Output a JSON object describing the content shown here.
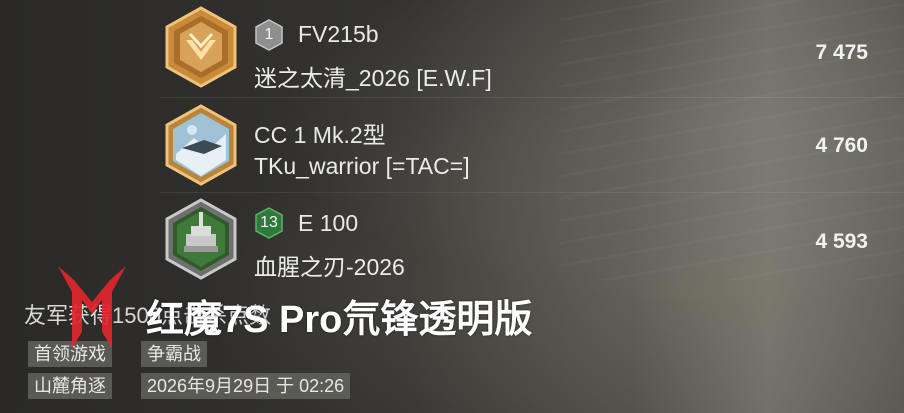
{
  "colors": {
    "accent_red": "#e0262c",
    "score_text": "#f2f2f2",
    "tag_bg": "#6a6a64"
  },
  "results": [
    {
      "emblem_icon": "gold-rank-emblem-icon",
      "tier_badge_icon": "silver-hex-badge-icon",
      "tier": "1",
      "vehicle": "FV215b",
      "player": "迷之太清_2026 [E.W.F]",
      "score": "7 475"
    },
    {
      "emblem_icon": "arctic-camo-emblem-icon",
      "tier_badge_icon": "",
      "tier": "",
      "vehicle": "CC 1 Mk.2型",
      "player": "TKu_warrior [=TAC=]",
      "score": "4 760"
    },
    {
      "emblem_icon": "green-tank-emblem-icon",
      "tier_badge_icon": "green-hex-badge-icon",
      "tier": "13",
      "vehicle": "E 100",
      "player": "血腥之刃-2026",
      "score": "4 593"
    }
  ],
  "footer": {
    "title": "友军获得1500点击杀点数",
    "tags_row1": [
      "首领游戏",
      "争霸战"
    ],
    "tags_row2": [
      "山麓角逐",
      "2026年9月29日 于 02:26"
    ]
  },
  "watermark": {
    "text": "红魔7S Pro氘锋透明版",
    "logo_icon": "red-magic-logo-icon"
  }
}
